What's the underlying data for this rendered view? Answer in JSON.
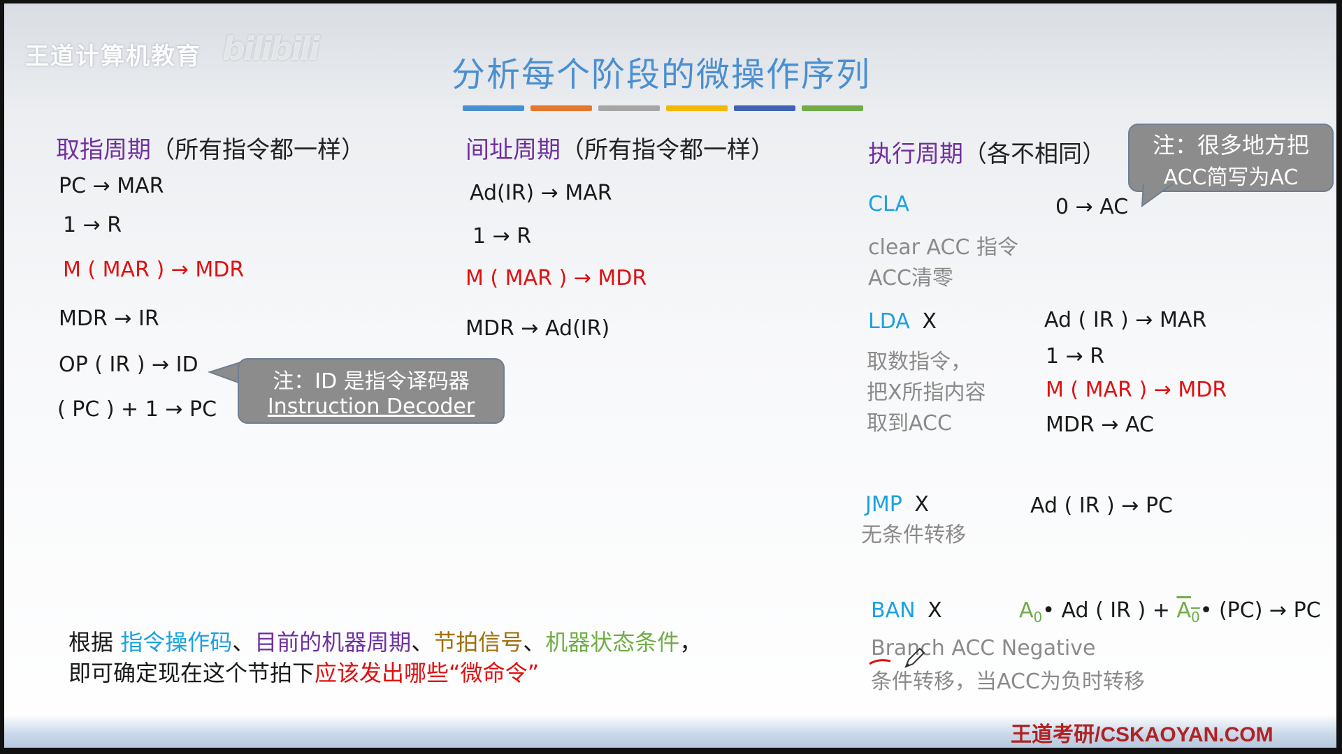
{
  "brand": {
    "text": "王道计算机教育",
    "logo": "bilibili"
  },
  "title": "分析每个阶段的微操作序列",
  "title_bar_colors": [
    "#4a8fd0",
    "#e8772e",
    "#a5a5a5",
    "#f5b800",
    "#3f62b5",
    "#70ad47"
  ],
  "fetch": {
    "header_tag": "取指周期",
    "header_rest": "（所有指令都一样）",
    "ops": [
      "PC → MAR",
      "1 → R",
      "M ( MAR ) → MDR",
      "MDR → IR",
      "OP ( IR ) → ID",
      "( PC ) + 1 → PC"
    ]
  },
  "indirect": {
    "header_tag": "间址周期",
    "header_rest": "（所有指令都一样）",
    "ops": [
      "Ad(IR) → MAR",
      "1 → R",
      "M ( MAR ) → MDR",
      "MDR → Ad(IR)"
    ]
  },
  "execute": {
    "header_tag": "执行周期",
    "header_rest": "（各不相同）",
    "cla": {
      "name": "CLA",
      "desc1": "clear ACC 指令",
      "desc2": "ACC清零",
      "op": "0 → AC"
    },
    "lda": {
      "name": "LDA",
      "arg": "X",
      "desc1": "取数指令，",
      "desc2": "把X所指内容",
      "desc3": "取到ACC",
      "ops": [
        "Ad ( IR ) → MAR",
        "1 → R",
        "M ( MAR ) → MDR",
        "MDR → AC"
      ]
    },
    "jmp": {
      "name": "JMP",
      "arg": "X",
      "desc": "无条件转移",
      "op": "Ad ( IR ) → PC"
    },
    "ban": {
      "name": "BAN",
      "arg": "X",
      "desc1": "Branch ACC Negative",
      "desc2": "条件转移，当ACC为负时转移",
      "op_a": "A",
      "op_sub": "0",
      "op_mid": "• Ad ( IR ) + ",
      "op_abar": "A",
      "op_sub2": "0",
      "op_end": "• (PC) → PC"
    }
  },
  "callouts": {
    "acc_note_line1": "注：很多地方把",
    "acc_note_line2": "ACC简写为AC",
    "id_note_line1": "注：ID 是指令译码器",
    "id_note_line2": "Instruction Decoder"
  },
  "summary": {
    "prefix": "根据 ",
    "k1": "指令操作码",
    "sep1": "、",
    "k2": "目前的机器周期",
    "sep2": "、",
    "k3": "节拍信号",
    "sep3": "、",
    "k4": "机器状态条件",
    "sep4": "，",
    "line2_prefix": "即可确定现在这个节拍下",
    "line2_red": "应该发出哪些“微命令”"
  },
  "footer": "王道考研/CSKAOYAN.COM"
}
